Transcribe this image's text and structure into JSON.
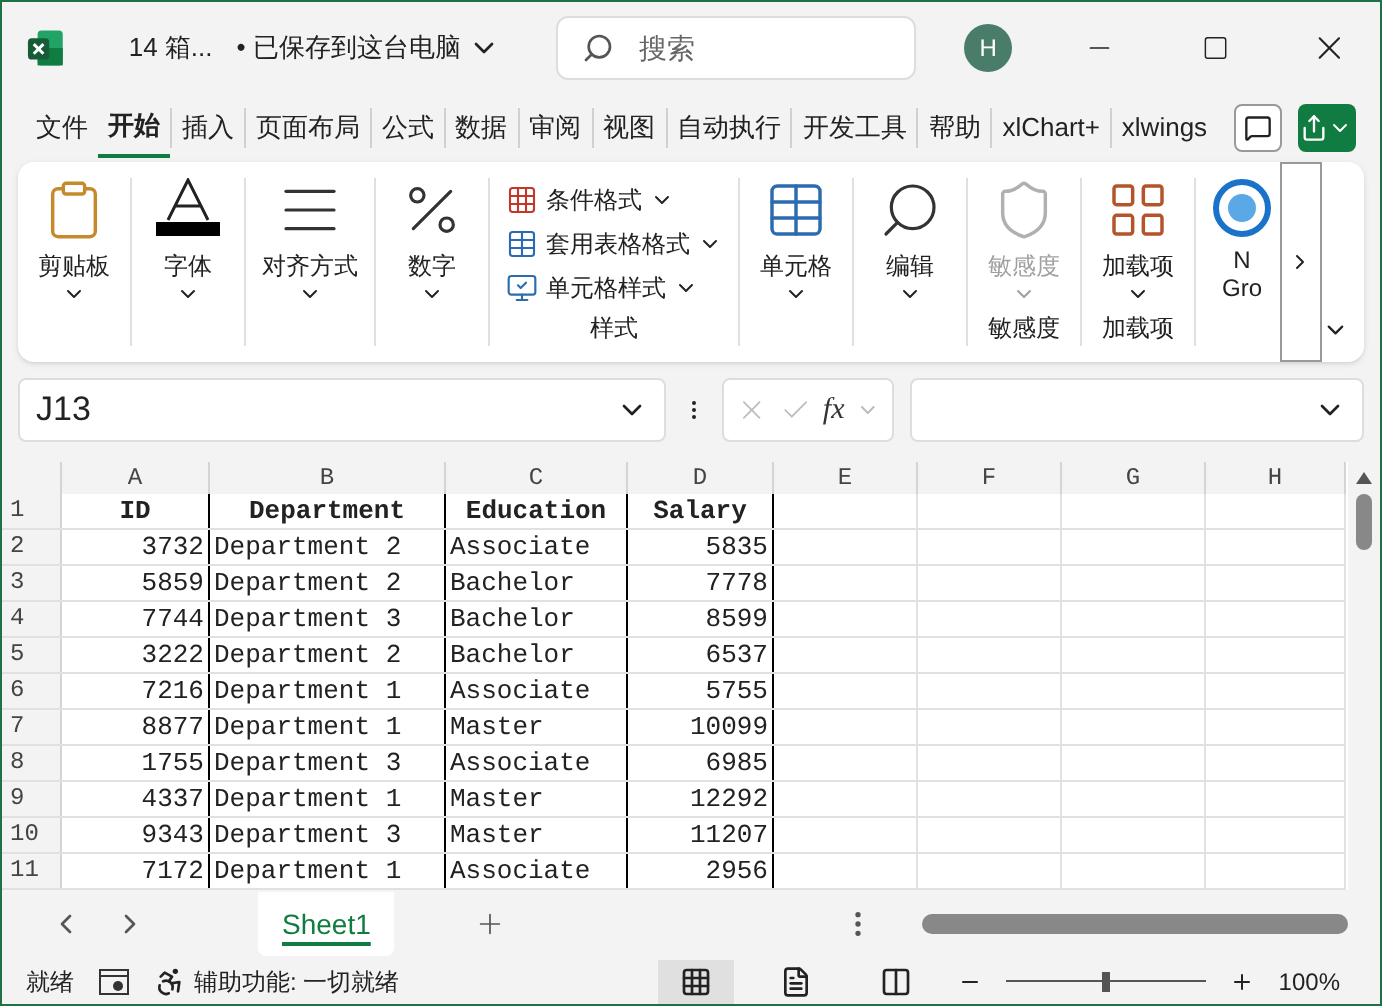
{
  "title_bar": {
    "file_name": "14 箱...",
    "save_status": "• 已保存到这台电脑",
    "search": {
      "placeholder": "搜索"
    },
    "avatar": "H"
  },
  "tabs": [
    {
      "label": "文件",
      "selected": false
    },
    {
      "label": "开始",
      "selected": true
    },
    {
      "label": "插入",
      "selected": false
    },
    {
      "label": "页面布局",
      "selected": false
    },
    {
      "label": "公式",
      "selected": false
    },
    {
      "label": "数据",
      "selected": false
    },
    {
      "label": "审阅",
      "selected": false
    },
    {
      "label": "视图",
      "selected": false
    },
    {
      "label": "自动执行",
      "selected": false
    },
    {
      "label": "开发工具",
      "selected": false
    },
    {
      "label": "帮助",
      "selected": false
    },
    {
      "label": "xlChart+",
      "selected": false
    },
    {
      "label": "xlwings",
      "selected": false
    }
  ],
  "ribbon": {
    "groups": [
      {
        "kind": "large",
        "items": [
          {
            "label": "剪贴板",
            "disabled": false
          }
        ]
      },
      {
        "kind": "large",
        "items": [
          {
            "label": "字体",
            "disabled": false
          }
        ]
      },
      {
        "kind": "large",
        "items": [
          {
            "label": "对齐方式",
            "disabled": false
          }
        ]
      },
      {
        "kind": "large",
        "items": [
          {
            "label": "数字",
            "disabled": false
          }
        ]
      },
      {
        "kind": "small",
        "label": "样式",
        "items": [
          {
            "label": "条件格式"
          },
          {
            "label": "套用表格格式"
          },
          {
            "label": "单元格样式"
          }
        ]
      },
      {
        "kind": "large",
        "items": [
          {
            "label": "单元格",
            "disabled": false
          }
        ]
      },
      {
        "kind": "large",
        "items": [
          {
            "label": "编辑",
            "disabled": false
          }
        ]
      },
      {
        "kind": "large",
        "label": "敏感度",
        "items": [
          {
            "label": "敏感度",
            "disabled": true
          }
        ]
      },
      {
        "kind": "large",
        "label": "加载项",
        "items": [
          {
            "label": "加载项",
            "disabled": false
          }
        ]
      },
      {
        "kind": "cut",
        "items": [
          {
            "label": "N Gro",
            "disabled": false
          }
        ]
      }
    ]
  },
  "formula_bar": {
    "name_box": "J13",
    "fx": "fx"
  },
  "grid": {
    "columns": [
      "A",
      "B",
      "C",
      "D",
      "E",
      "F",
      "G",
      "H"
    ],
    "header_row": {
      "number": "1",
      "cells": [
        "ID",
        "Department",
        "Education",
        "Salary"
      ]
    },
    "rows": [
      {
        "number": "2",
        "cells": [
          "3732",
          "Department 2",
          "Associate",
          "5835"
        ]
      },
      {
        "number": "3",
        "cells": [
          "5859",
          "Department 2",
          "Bachelor",
          "7778"
        ]
      },
      {
        "number": "4",
        "cells": [
          "7744",
          "Department 3",
          "Bachelor",
          "8599"
        ]
      },
      {
        "number": "5",
        "cells": [
          "3222",
          "Department 2",
          "Bachelor",
          "6537"
        ]
      },
      {
        "number": "6",
        "cells": [
          "7216",
          "Department 1",
          "Associate",
          "5755"
        ]
      },
      {
        "number": "7",
        "cells": [
          "8877",
          "Department 1",
          "Master",
          "10099"
        ]
      },
      {
        "number": "8",
        "cells": [
          "1755",
          "Department 3",
          "Associate",
          "6985"
        ]
      },
      {
        "number": "9",
        "cells": [
          "4337",
          "Department 1",
          "Master",
          "12292"
        ]
      },
      {
        "number": "10",
        "cells": [
          "9343",
          "Department 3",
          "Master",
          "11207"
        ]
      },
      {
        "number": "11",
        "cells": [
          "7172",
          "Department 1",
          "Associate",
          "2956"
        ]
      }
    ]
  },
  "sheets": [
    {
      "label": "Sheet1",
      "selected": true
    }
  ],
  "status_bar": {
    "ready": "就绪",
    "accessibility": "辅助功能: 一切就绪",
    "views": [
      {
        "selected": true
      },
      {
        "selected": false
      },
      {
        "selected": false
      }
    ],
    "zoom": {
      "level": 0.5,
      "reading": "100%"
    }
  }
}
